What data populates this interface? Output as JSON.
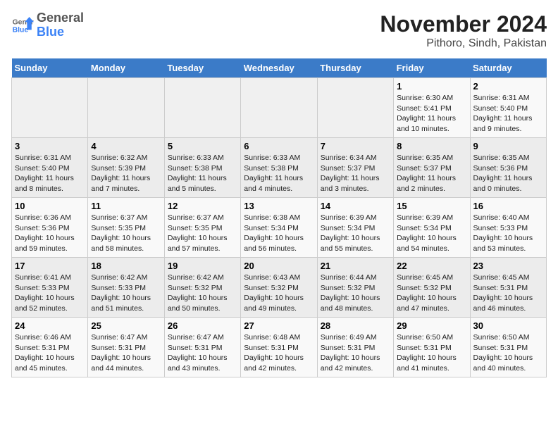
{
  "logo": {
    "general": "General",
    "blue": "Blue"
  },
  "title": "November 2024",
  "subtitle": "Pithoro, Sindh, Pakistan",
  "weekdays": [
    "Sunday",
    "Monday",
    "Tuesday",
    "Wednesday",
    "Thursday",
    "Friday",
    "Saturday"
  ],
  "weeks": [
    [
      {
        "day": "",
        "detail": ""
      },
      {
        "day": "",
        "detail": ""
      },
      {
        "day": "",
        "detail": ""
      },
      {
        "day": "",
        "detail": ""
      },
      {
        "day": "",
        "detail": ""
      },
      {
        "day": "1",
        "detail": "Sunrise: 6:30 AM\nSunset: 5:41 PM\nDaylight: 11 hours and 10 minutes."
      },
      {
        "day": "2",
        "detail": "Sunrise: 6:31 AM\nSunset: 5:40 PM\nDaylight: 11 hours and 9 minutes."
      }
    ],
    [
      {
        "day": "3",
        "detail": "Sunrise: 6:31 AM\nSunset: 5:40 PM\nDaylight: 11 hours and 8 minutes."
      },
      {
        "day": "4",
        "detail": "Sunrise: 6:32 AM\nSunset: 5:39 PM\nDaylight: 11 hours and 7 minutes."
      },
      {
        "day": "5",
        "detail": "Sunrise: 6:33 AM\nSunset: 5:38 PM\nDaylight: 11 hours and 5 minutes."
      },
      {
        "day": "6",
        "detail": "Sunrise: 6:33 AM\nSunset: 5:38 PM\nDaylight: 11 hours and 4 minutes."
      },
      {
        "day": "7",
        "detail": "Sunrise: 6:34 AM\nSunset: 5:37 PM\nDaylight: 11 hours and 3 minutes."
      },
      {
        "day": "8",
        "detail": "Sunrise: 6:35 AM\nSunset: 5:37 PM\nDaylight: 11 hours and 2 minutes."
      },
      {
        "day": "9",
        "detail": "Sunrise: 6:35 AM\nSunset: 5:36 PM\nDaylight: 11 hours and 0 minutes."
      }
    ],
    [
      {
        "day": "10",
        "detail": "Sunrise: 6:36 AM\nSunset: 5:36 PM\nDaylight: 10 hours and 59 minutes."
      },
      {
        "day": "11",
        "detail": "Sunrise: 6:37 AM\nSunset: 5:35 PM\nDaylight: 10 hours and 58 minutes."
      },
      {
        "day": "12",
        "detail": "Sunrise: 6:37 AM\nSunset: 5:35 PM\nDaylight: 10 hours and 57 minutes."
      },
      {
        "day": "13",
        "detail": "Sunrise: 6:38 AM\nSunset: 5:34 PM\nDaylight: 10 hours and 56 minutes."
      },
      {
        "day": "14",
        "detail": "Sunrise: 6:39 AM\nSunset: 5:34 PM\nDaylight: 10 hours and 55 minutes."
      },
      {
        "day": "15",
        "detail": "Sunrise: 6:39 AM\nSunset: 5:34 PM\nDaylight: 10 hours and 54 minutes."
      },
      {
        "day": "16",
        "detail": "Sunrise: 6:40 AM\nSunset: 5:33 PM\nDaylight: 10 hours and 53 minutes."
      }
    ],
    [
      {
        "day": "17",
        "detail": "Sunrise: 6:41 AM\nSunset: 5:33 PM\nDaylight: 10 hours and 52 minutes."
      },
      {
        "day": "18",
        "detail": "Sunrise: 6:42 AM\nSunset: 5:33 PM\nDaylight: 10 hours and 51 minutes."
      },
      {
        "day": "19",
        "detail": "Sunrise: 6:42 AM\nSunset: 5:32 PM\nDaylight: 10 hours and 50 minutes."
      },
      {
        "day": "20",
        "detail": "Sunrise: 6:43 AM\nSunset: 5:32 PM\nDaylight: 10 hours and 49 minutes."
      },
      {
        "day": "21",
        "detail": "Sunrise: 6:44 AM\nSunset: 5:32 PM\nDaylight: 10 hours and 48 minutes."
      },
      {
        "day": "22",
        "detail": "Sunrise: 6:45 AM\nSunset: 5:32 PM\nDaylight: 10 hours and 47 minutes."
      },
      {
        "day": "23",
        "detail": "Sunrise: 6:45 AM\nSunset: 5:31 PM\nDaylight: 10 hours and 46 minutes."
      }
    ],
    [
      {
        "day": "24",
        "detail": "Sunrise: 6:46 AM\nSunset: 5:31 PM\nDaylight: 10 hours and 45 minutes."
      },
      {
        "day": "25",
        "detail": "Sunrise: 6:47 AM\nSunset: 5:31 PM\nDaylight: 10 hours and 44 minutes."
      },
      {
        "day": "26",
        "detail": "Sunrise: 6:47 AM\nSunset: 5:31 PM\nDaylight: 10 hours and 43 minutes."
      },
      {
        "day": "27",
        "detail": "Sunrise: 6:48 AM\nSunset: 5:31 PM\nDaylight: 10 hours and 42 minutes."
      },
      {
        "day": "28",
        "detail": "Sunrise: 6:49 AM\nSunset: 5:31 PM\nDaylight: 10 hours and 42 minutes."
      },
      {
        "day": "29",
        "detail": "Sunrise: 6:50 AM\nSunset: 5:31 PM\nDaylight: 10 hours and 41 minutes."
      },
      {
        "day": "30",
        "detail": "Sunrise: 6:50 AM\nSunset: 5:31 PM\nDaylight: 10 hours and 40 minutes."
      }
    ]
  ]
}
